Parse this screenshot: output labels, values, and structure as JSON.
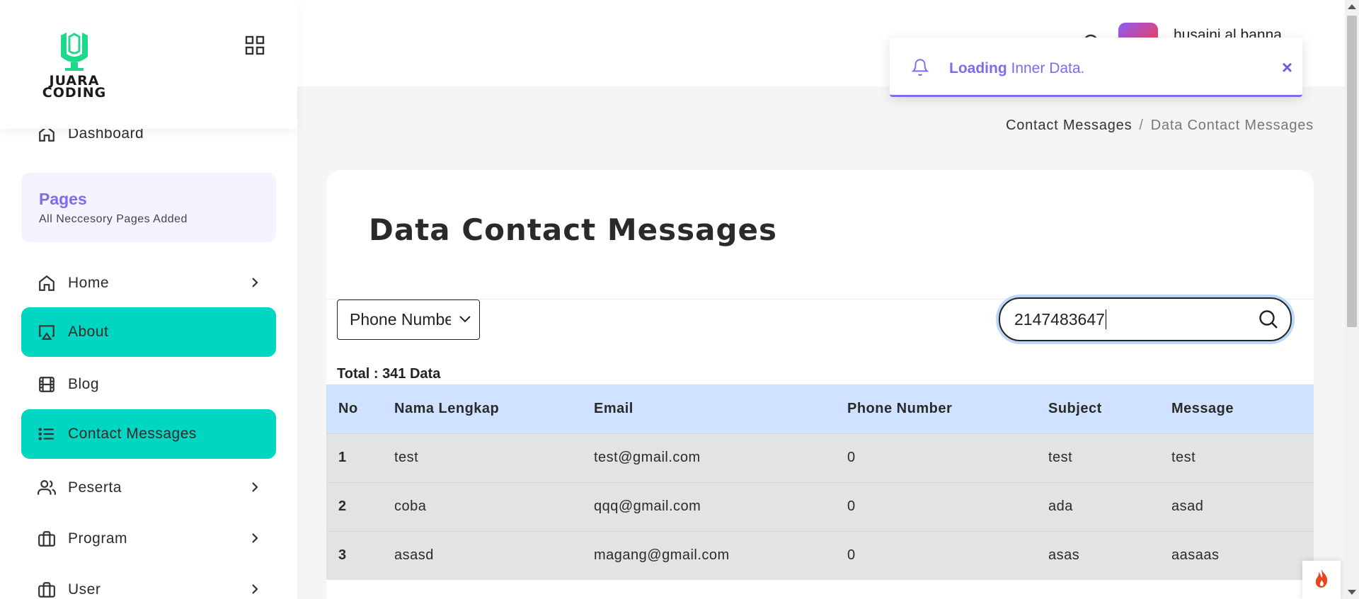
{
  "brand": {
    "name_line1": "JUARA",
    "name_line2": "CODING",
    "color": "#1fd98a"
  },
  "sidebar": {
    "dashboard_label": "Dashboard",
    "pages_box": {
      "title": "Pages",
      "subtitle": "All Neccesory Pages Added"
    },
    "items": [
      {
        "label": "Home",
        "icon": "home-icon",
        "active": false,
        "has_chevron": true
      },
      {
        "label": "About",
        "icon": "airplay-icon",
        "active": true,
        "has_chevron": false
      },
      {
        "label": "Blog",
        "icon": "film-icon",
        "active": false,
        "has_chevron": false
      },
      {
        "label": "Contact Messages",
        "icon": "list-icon",
        "active": true,
        "has_chevron": false
      },
      {
        "label": "Peserta",
        "icon": "users-icon",
        "active": false,
        "has_chevron": true
      },
      {
        "label": "Program",
        "icon": "briefcase-icon",
        "active": false,
        "has_chevron": true
      },
      {
        "label": "User",
        "icon": "briefcase-icon",
        "active": false,
        "has_chevron": true
      }
    ],
    "active_color": "#00d6c2"
  },
  "header": {
    "user_name": "husaini al banna"
  },
  "toast": {
    "bold": "Loading",
    "text": " Inner Data.",
    "close": "×",
    "accent": "#7b6cf0"
  },
  "breadcrumb": {
    "parent": "Contact Messages",
    "separator": "/",
    "current": "Data Contact Messages"
  },
  "main": {
    "title": "Data Contact Messages",
    "filter": {
      "selected": "Phone Number"
    },
    "search": {
      "value": "2147483647"
    },
    "total": "Total : 341 Data",
    "table": {
      "headers": [
        "No",
        "Nama Lengkap",
        "Email",
        "Phone Number",
        "Subject",
        "Message"
      ],
      "rows": [
        [
          "1",
          "test",
          "test@gmail.com",
          "0",
          "test",
          "test"
        ],
        [
          "2",
          "coba",
          "qqq@gmail.com",
          "0",
          "ada",
          "asad"
        ],
        [
          "3",
          "asasd",
          "magang@gmail.com",
          "0",
          "asas",
          "aasaas"
        ]
      ]
    }
  }
}
